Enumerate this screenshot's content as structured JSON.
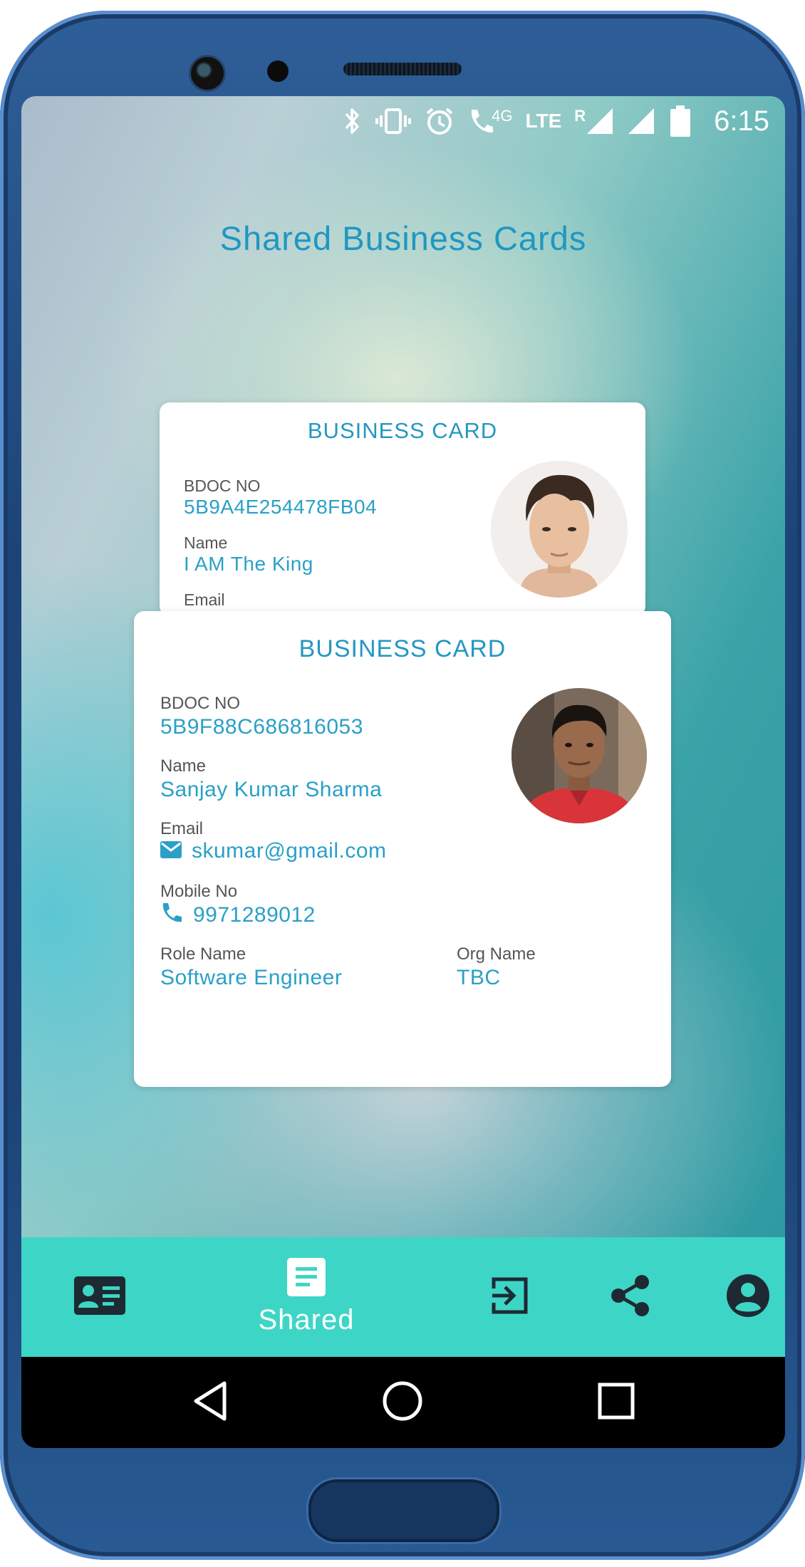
{
  "status_bar": {
    "network_4g": "4G",
    "network_lte": "LTE",
    "roaming": "R",
    "time": "6:15"
  },
  "page": {
    "title": "Shared Business Cards"
  },
  "cards": [
    {
      "heading": "BUSINESS CARD",
      "bdoc_label": "BDOC NO",
      "bdoc_value": "5B9A4E254478FB04",
      "name_label": "Name",
      "name_value": "I AM The King",
      "email_label": "Email"
    },
    {
      "heading": "BUSINESS CARD",
      "bdoc_label": "BDOC NO",
      "bdoc_value": "5B9F88C686816053",
      "name_label": "Name",
      "name_value": "Sanjay Kumar Sharma",
      "email_label": "Email",
      "email_value": "skumar@gmail.com",
      "mobile_label": "Mobile No",
      "mobile_value": "9971289012",
      "role_label": "Role Name",
      "role_value": "Software Engineer",
      "org_label": "Org Name",
      "org_value": "TBC"
    }
  ],
  "bottom_nav": {
    "items": [
      {
        "icon": "id-card-icon",
        "active": false
      },
      {
        "icon": "document-icon",
        "label": "Shared",
        "active": true
      },
      {
        "icon": "sign-in-icon",
        "active": false
      },
      {
        "icon": "share-icon",
        "active": false
      },
      {
        "icon": "account-circle-icon",
        "active": false
      }
    ]
  },
  "colors": {
    "accent_text": "#2aa0c7",
    "title_text": "#1f97c2",
    "bottom_nav_bg": "#3dd6c6",
    "icon_dark": "#1e2a33"
  }
}
